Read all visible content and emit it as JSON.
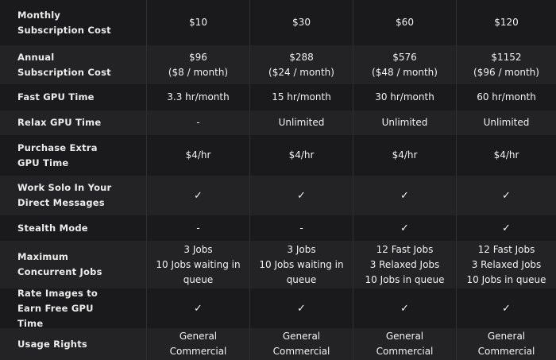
{
  "colors": {
    "plan_basic": "#1a8f86",
    "plan_standard": "#5a4fd6",
    "plan_pro": "#e07b15",
    "plan_mega": "#4b4f86",
    "row_dark": "#1a1a1c",
    "row_light": "#232325"
  },
  "check_icon": "checkmark-icon",
  "rows": [
    {
      "label": "Monthly Subscription Cost",
      "cells": [
        [
          "$10"
        ],
        [
          "$30"
        ],
        [
          "$60"
        ],
        [
          "$120"
        ]
      ]
    },
    {
      "label": "Annual Subscription Cost",
      "cells": [
        [
          "$96",
          "($8 / month)"
        ],
        [
          "$288",
          "($24 / month)"
        ],
        [
          "$576",
          "($48 / month)"
        ],
        [
          "$1152",
          "($96 / month)"
        ]
      ]
    },
    {
      "label": "Fast GPU Time",
      "cells": [
        [
          "3.3 hr/month"
        ],
        [
          "15 hr/month"
        ],
        [
          "30 hr/month"
        ],
        [
          "60 hr/month"
        ]
      ]
    },
    {
      "label": "Relax GPU Time",
      "cells": [
        [
          "-"
        ],
        [
          "Unlimited"
        ],
        [
          "Unlimited"
        ],
        [
          "Unlimited"
        ]
      ]
    },
    {
      "label": "Purchase Extra GPU Time",
      "cells": [
        [
          "$4/hr"
        ],
        [
          "$4/hr"
        ],
        [
          "$4/hr"
        ],
        [
          "$4/hr"
        ]
      ]
    },
    {
      "label": "Work Solo In Your Direct Messages",
      "cells": [
        [
          "✓"
        ],
        [
          "✓"
        ],
        [
          "✓"
        ],
        [
          "✓"
        ]
      ]
    },
    {
      "label": "Stealth Mode",
      "cells": [
        [
          "-"
        ],
        [
          "-"
        ],
        [
          "✓"
        ],
        [
          "✓"
        ]
      ]
    },
    {
      "label": "Maximum Concurrent Jobs",
      "cells": [
        [
          "3 Jobs",
          "10 Jobs waiting in",
          "queue"
        ],
        [
          "3 Jobs",
          "10 Jobs waiting in",
          "queue"
        ],
        [
          "12 Fast Jobs",
          "3 Relaxed Jobs",
          "10 Jobs in queue"
        ],
        [
          "12 Fast Jobs",
          "3 Relaxed Jobs",
          "10 Jobs in queue"
        ]
      ]
    },
    {
      "label": "Rate Images to Earn Free GPU Time",
      "cells": [
        [
          "✓"
        ],
        [
          "✓"
        ],
        [
          "✓"
        ],
        [
          "✓"
        ]
      ]
    },
    {
      "label": "Usage Rights",
      "cells": [
        [
          "General",
          "Commercial"
        ],
        [
          "General",
          "Commercial"
        ],
        [
          "General",
          "Commercial"
        ],
        [
          "General",
          "Commercial"
        ]
      ]
    }
  ]
}
